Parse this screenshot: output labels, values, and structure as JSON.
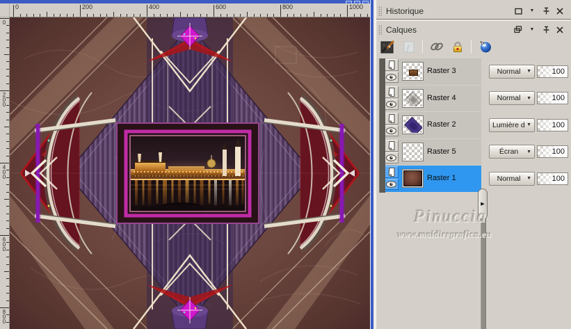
{
  "canvas": {
    "h_ruler_labels": [
      "0",
      "200",
      "400",
      "600",
      "800",
      "1000"
    ],
    "v_ruler_labels": [
      "0",
      "200",
      "400",
      "600",
      "800"
    ],
    "artwork_description": "kaleidoscopic purple-brown collage with framed night cityscape"
  },
  "panels": {
    "history": {
      "title": "Historique"
    },
    "layers": {
      "title": "Calques",
      "toolbar": [
        {
          "name": "new-raster-layer-icon",
          "enabled": true
        },
        {
          "name": "new-mask-layer-icon",
          "enabled": false
        },
        {
          "name": "link-layers-icon",
          "enabled": true
        },
        {
          "name": "lock-transparency-icon",
          "enabled": true
        },
        {
          "name": "edit-selection-icon",
          "enabled": true
        }
      ],
      "rows": [
        {
          "name": "Raster 3",
          "blend": "Normal",
          "opacity": "100",
          "selected": false,
          "thumb": "chip-brown"
        },
        {
          "name": "Raster 4",
          "blend": "Normal",
          "opacity": "100",
          "selected": false,
          "thumb": "diamond-gray"
        },
        {
          "name": "Raster 2",
          "blend": "Lumière dure",
          "opacity": "100",
          "selected": false,
          "thumb": "diamond-purple"
        },
        {
          "name": "Raster 5",
          "blend": "Écran",
          "opacity": "100",
          "selected": false,
          "thumb": "blank"
        },
        {
          "name": "Raster 1",
          "blend": "Normal",
          "opacity": "100",
          "selected": true,
          "thumb": "texture-brown"
        }
      ]
    },
    "watermark": {
      "line1": "Pinuccia",
      "line2": "www.maidiregrafica.eu"
    }
  },
  "icons": {
    "dropdown_arrow": "▼",
    "splitter_arrow": "▶",
    "header_icons": [
      "float-window-icon",
      "dropdown-arrow-icon",
      "pin-icon",
      "close-icon"
    ]
  },
  "colors": {
    "selection_blue": "#2f97ef",
    "panel_bg": "#d4d0c9",
    "window_border_blue": "#3b5cc4",
    "pane_divider": "#5e5b56"
  }
}
